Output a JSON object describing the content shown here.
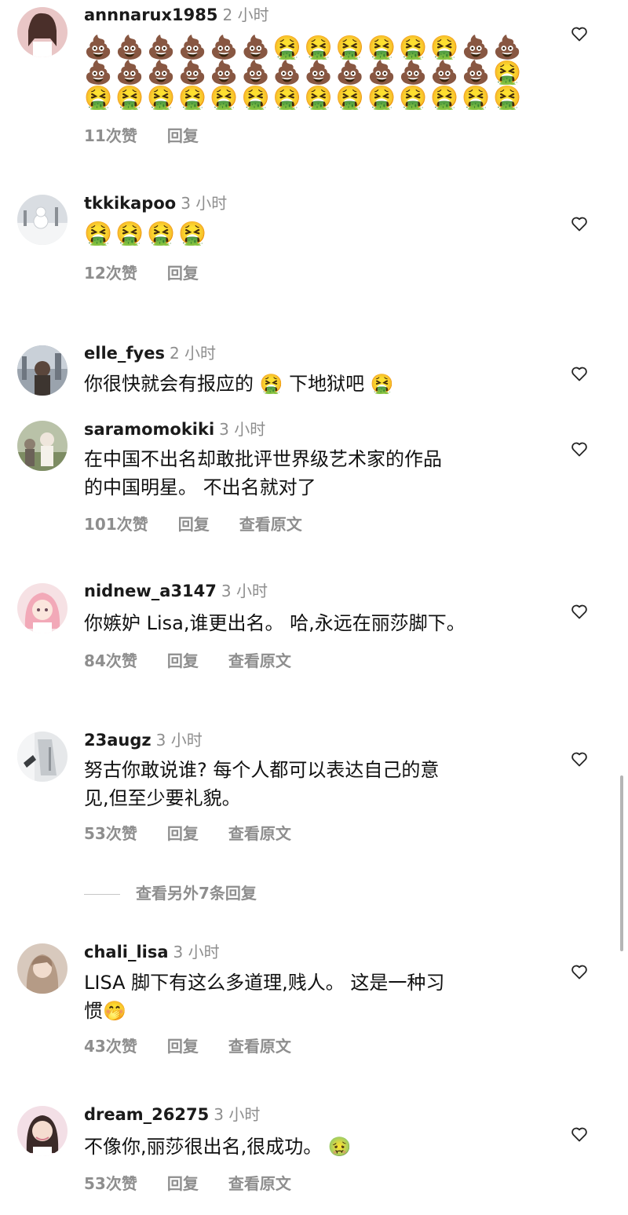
{
  "comments": [
    {
      "username": "annnarux1985",
      "time": "2 小时",
      "emoji_lines": [
        "💩💩💩💩💩💩🤮🤮🤮🤮🤮🤮💩💩",
        "💩💩💩💩💩💩💩💩💩💩💩💩💩🤮",
        "🤮🤮🤮🤮🤮🤮🤮🤮🤮🤮🤮🤮🤮🤮"
      ],
      "likes": "11次赞",
      "reply": "回复"
    },
    {
      "username": "tkkikapoo",
      "time": "3 小时",
      "emoji_lines": [
        "🤮🤮🤮🤮"
      ],
      "likes": "12次赞",
      "reply": "回复"
    },
    {
      "username": "elle_fyes",
      "time": "2 小时",
      "text": "你很快就会有报应的 🤮 下地狱吧 🤮"
    },
    {
      "username": "saramomokiki",
      "time": "3 小时",
      "text_lines": [
        "在中国不出名却敢批评世界级艺术家的作品",
        "的中国明星。 不出名就对了"
      ],
      "likes": "101次赞",
      "reply": "回复",
      "translate": "查看原文"
    },
    {
      "username": "nidnew_a3147",
      "time": "3 小时",
      "text": "你嫉妒 Lisa,谁更出名。 哈,永远在丽莎脚下。",
      "likes": "84次赞",
      "reply": "回复",
      "translate": "查看原文"
    },
    {
      "username": "23augz",
      "time": "3 小时",
      "text_lines": [
        "努古你敢说谁? 每个人都可以表达自己的意",
        "见,但至少要礼貌。"
      ],
      "likes": "53次赞",
      "reply": "回复",
      "translate": "查看原文"
    },
    {
      "username": "chali_lisa",
      "time": "3 小时",
      "text_lines": [
        "LISA 脚下有这么多道理,贱人。 这是一种习",
        "惯🤭"
      ],
      "likes": "43次赞",
      "reply": "回复",
      "translate": "查看原文"
    },
    {
      "username": "dream_26275",
      "time": "3 小时",
      "text": "不像你,丽莎很出名,很成功。 🤢",
      "likes": "53次赞",
      "reply": "回复",
      "translate": "查看原文"
    }
  ],
  "more_replies": "查看另外7条回复",
  "colors": {
    "secondary_text": "#8e8e8e",
    "primary_text": "#111111",
    "username": "#1a1a1a"
  },
  "icons": {
    "like": "heart-outline-icon"
  }
}
